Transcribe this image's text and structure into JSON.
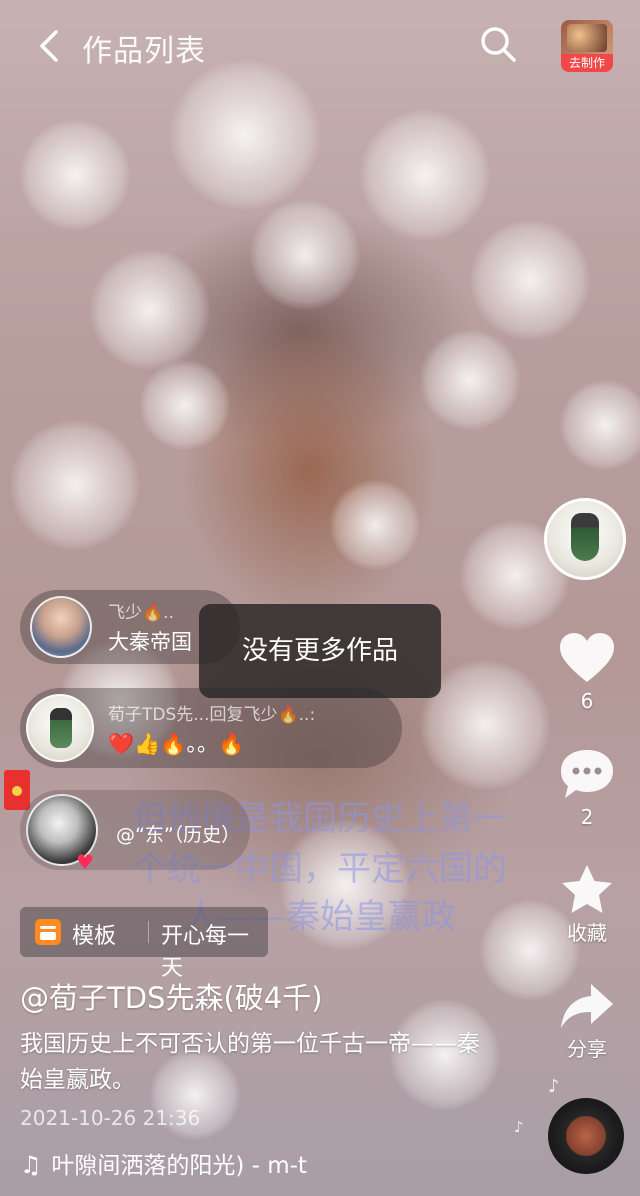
{
  "header": {
    "title": "作品列表",
    "make_button_label": "去制作"
  },
  "video_overlay_text": {
    "line1": "但他确是我国历史上第一",
    "line2": "个统一中国，平定六国的",
    "line3": "人——秦始皇嬴政"
  },
  "toast": {
    "message": "没有更多作品"
  },
  "comments": [
    {
      "user": "飞少🔥..",
      "text": "大秦帝国"
    },
    {
      "user": "荀子TDS先...回复飞少🔥..:",
      "text": "❤️👍🔥。。🔥"
    },
    {
      "user": "",
      "text": "@“东”（历史）"
    }
  ],
  "actions": {
    "like_count": "6",
    "comment_count": "2",
    "favorite_label": "收藏",
    "share_label": "分享"
  },
  "template": {
    "label": "模板",
    "name": "开心每一天"
  },
  "post": {
    "author": "@荀子TDS先森(破4千)",
    "description": "我国历史上不可否认的第一位千古一帝——秦始皇嬴政。",
    "date": "2021-10-26 21:36",
    "music": "叶隙间洒落的阳光) - m-t"
  },
  "colors": {
    "toast_bg": "#282426",
    "make_label_bg": "#f04848",
    "heart_badge": "#ff2d55",
    "template_icon": "#ff8a1f"
  }
}
